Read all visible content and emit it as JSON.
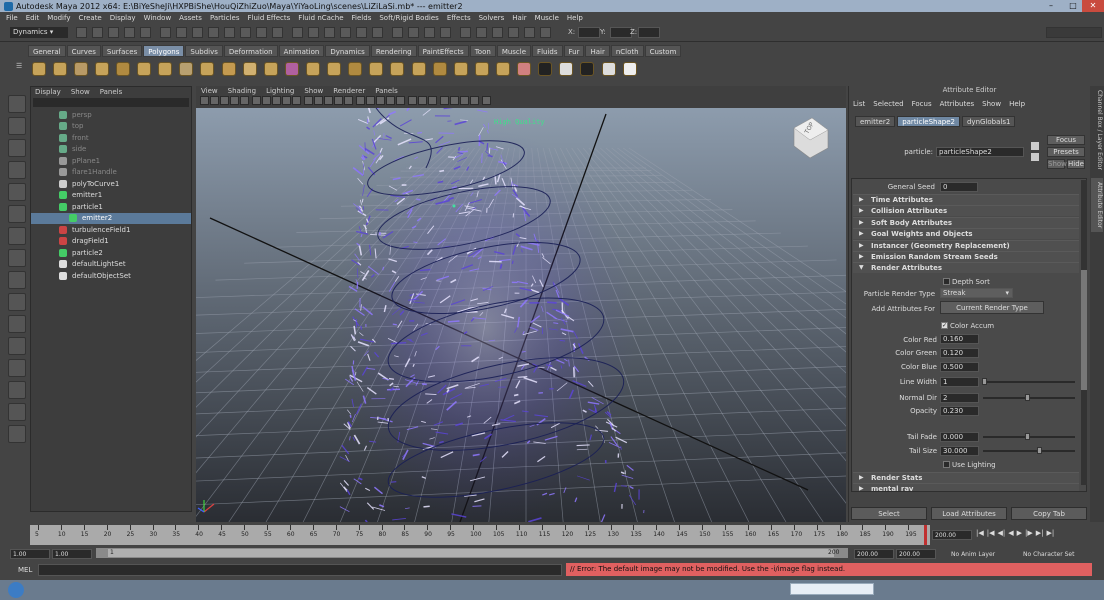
{
  "window": {
    "title": "Autodesk Maya 2012 x64: E:\\BiYeSheJi\\HXPBiShe\\HouQiZhiZuo\\Maya\\YiYaoLing\\scenes\\LiZiLaSi.mb*   ---   emitter2"
  },
  "menubar": [
    "File",
    "Edit",
    "Modify",
    "Create",
    "Display",
    "Window",
    "Assets",
    "Particles",
    "Fluid Effects",
    "Fluid nCache",
    "Fields",
    "Soft/Rigid Bodies",
    "Effects",
    "Solvers",
    "Hair",
    "Muscle",
    "Help"
  ],
  "status_line": {
    "mode": "Dynamics",
    "x_label": "X:",
    "y_label": "Y:",
    "z_label": "Z:"
  },
  "shelf_tabs": [
    "General",
    "Curves",
    "Surfaces",
    "Polygons",
    "Subdivs",
    "Deformation",
    "Animation",
    "Dynamics",
    "Rendering",
    "PaintEffects",
    "Toon",
    "Muscle",
    "Fluids",
    "Fur",
    "Hair",
    "nCloth",
    "Custom"
  ],
  "shelf_active": "Polygons",
  "outliner": {
    "menu": [
      "Display",
      "Show",
      "Panels"
    ],
    "items": [
      {
        "label": "persp",
        "style": "dim",
        "icon": "camera-icon"
      },
      {
        "label": "top",
        "style": "dim",
        "icon": "camera-icon"
      },
      {
        "label": "front",
        "style": "dim",
        "icon": "camera-icon"
      },
      {
        "label": "side",
        "style": "dim",
        "icon": "camera-icon"
      },
      {
        "label": "pPlane1",
        "style": "dim",
        "icon": "mesh-icon"
      },
      {
        "label": "flare1Handle",
        "style": "dim",
        "icon": "handle-icon"
      },
      {
        "label": "polyToCurve1",
        "style": "normal",
        "icon": "curve-icon"
      },
      {
        "label": "emitter1",
        "style": "normal",
        "icon": "emitter-icon"
      },
      {
        "label": "particle1",
        "style": "normal",
        "icon": "particle-icon"
      },
      {
        "label": "emitter2",
        "style": "selected",
        "icon": "emitter-icon"
      },
      {
        "label": "turbulenceField1",
        "style": "normal",
        "icon": "field-icon"
      },
      {
        "label": "dragField1",
        "style": "normal",
        "icon": "field-icon"
      },
      {
        "label": "particle2",
        "style": "normal",
        "icon": "particle-icon"
      },
      {
        "label": "defaultLightSet",
        "style": "normal",
        "icon": "set-icon"
      },
      {
        "label": "defaultObjectSet",
        "style": "normal",
        "icon": "set-icon"
      }
    ]
  },
  "viewport": {
    "menu": [
      "View",
      "Shading",
      "Lighting",
      "Show",
      "Renderer",
      "Panels"
    ],
    "hud_text": "High Quality",
    "viewcube_label": "TOP"
  },
  "attribute_editor": {
    "title": "Attribute Editor",
    "menu": [
      "List",
      "Selected",
      "Focus",
      "Attributes",
      "Show",
      "Help"
    ],
    "tabs": [
      "emitter2",
      "particleShape2",
      "dynGlobals1"
    ],
    "active_tab": "particleShape2",
    "node_label": "particle:",
    "node_value": "particleShape2",
    "focus_button": "Focus",
    "presets_button": "Presets",
    "show_button": "Show",
    "hide_button": "Hide",
    "general_seed_label": "General Seed",
    "general_seed_value": "0",
    "sections": [
      "Time Attributes",
      "Collision Attributes",
      "Soft Body Attributes",
      "Goal Weights and Objects",
      "Instancer (Geometry Replacement)",
      "Emission Random Stream Seeds",
      "Render Attributes"
    ],
    "render": {
      "depth_sort": "Depth Sort",
      "render_type_label": "Particle Render Type",
      "render_type_value": "Streak",
      "add_attr_label": "Add Attributes For",
      "add_attr_button": "Current Render Type",
      "color_accum": "Color Accum",
      "color_red_label": "Color Red",
      "color_red": "0.160",
      "color_green_label": "Color Green",
      "color_green": "0.120",
      "color_blue_label": "Color Blue",
      "color_blue": "0.500",
      "line_width_label": "Line Width",
      "line_width": "1",
      "normal_dir_label": "Normal Dir",
      "normal_dir": "2",
      "opacity_label": "Opacity",
      "opacity": "0.230",
      "tail_fade_label": "Tail Fade",
      "tail_fade": "0.000",
      "tail_size_label": "Tail Size",
      "tail_size": "30.000",
      "use_lighting": "Use Lighting"
    },
    "after_sections": [
      "Render Stats",
      "mental ray"
    ],
    "select_button": "Select",
    "load_button": "Load Attributes",
    "copy_button": "Copy Tab"
  },
  "side_tabs": [
    "Channel Box / Layer Editor",
    "Attribute Editor"
  ],
  "timeline": {
    "ticks": [
      "5",
      "10",
      "15",
      "20",
      "25",
      "30",
      "35",
      "40",
      "45",
      "50",
      "55",
      "60",
      "65",
      "70",
      "75",
      "80",
      "85",
      "90",
      "95",
      "100",
      "105",
      "110",
      "115",
      "120",
      "125",
      "130",
      "135",
      "140",
      "145",
      "150",
      "155",
      "160",
      "165",
      "170",
      "175",
      "180",
      "185",
      "190",
      "195"
    ],
    "current_frame": "200.00"
  },
  "range": {
    "start": "1.00",
    "playback_start": "1.00",
    "range_start_label": "1",
    "range_end_label": "200",
    "playback_end": "200.00",
    "end": "200.00",
    "anim_layer": "No Anim Layer",
    "character_set": "No Character Set"
  },
  "mel": {
    "label": "MEL",
    "error": "// Error: The default image may not be modified.  Use the -i/image flag instead."
  }
}
